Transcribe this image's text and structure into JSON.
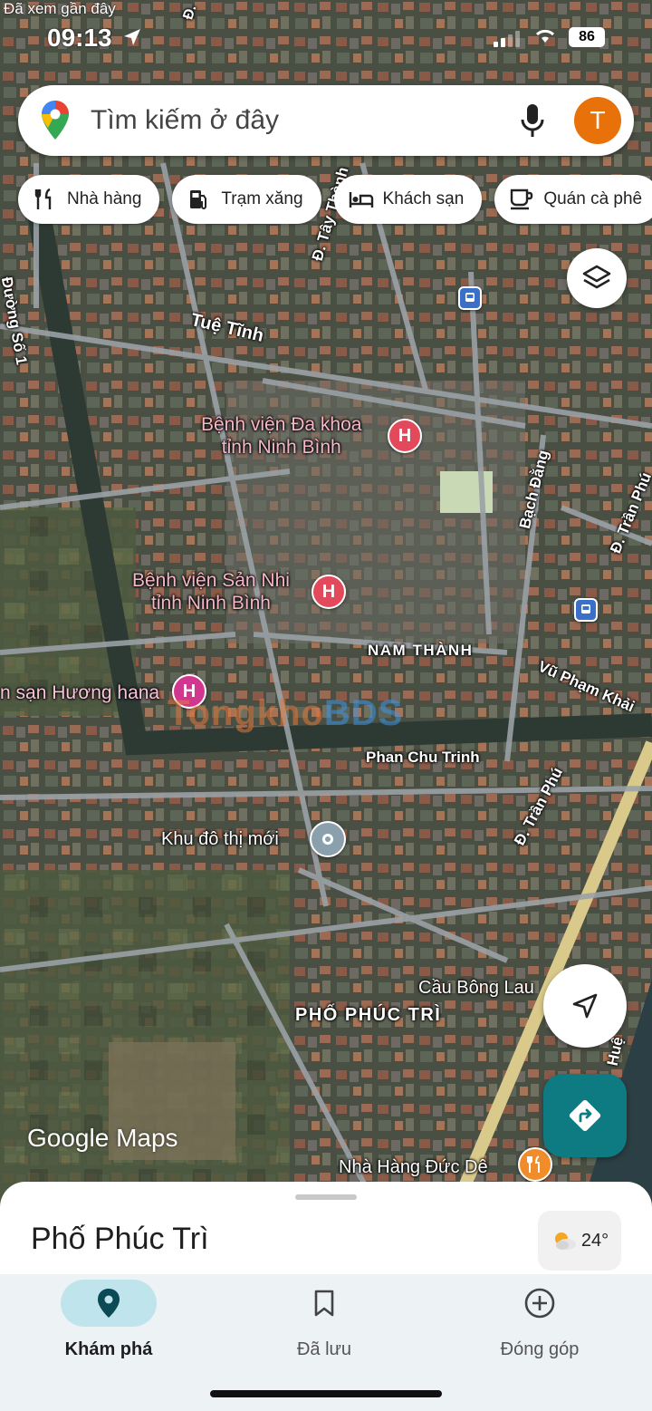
{
  "status": {
    "back_label": "Đã xem gần đây",
    "time": "09:13",
    "battery": "86"
  },
  "search": {
    "placeholder": "Tìm kiếm ở đây",
    "avatar_letter": "T"
  },
  "chips": [
    {
      "label": "Nhà hàng",
      "icon": "restaurant-icon"
    },
    {
      "label": "Trạm xăng",
      "icon": "gas-station-icon"
    },
    {
      "label": "Khách sạn",
      "icon": "hotel-icon"
    },
    {
      "label": "Quán cà phê",
      "icon": "coffee-icon"
    }
  ],
  "map": {
    "streets": {
      "tue_tinh": "Tuệ Tĩnh",
      "duong_so_1": "Đường Số 1",
      "tay_thanh": "Đ. Tây Thành",
      "bach_dang": "Bạch Đằng",
      "tran_phu_top": "Đ. Trần Phú",
      "vu_pham_khai": "Vũ Phạm Khải",
      "phan_chu_trinh": "Phan Chu Trinh",
      "tran_phu_bottom": "Đ. Trần Phú",
      "hue": "Huệ",
      "top_left": "Đ."
    },
    "places": {
      "hospital1_line1": "Bệnh viện Đa khoa",
      "hospital1_line2": "tỉnh Ninh Bình",
      "hospital2_line1": "Bệnh viện Sản Nhi",
      "hospital2_line2": "tỉnh Ninh Bình",
      "nam_thanh": "NAM THÀNH",
      "hotel": "n sạn Hương hana",
      "khu_do_thi": "Khu đô thị mới",
      "cau_bong_lau": "Cầu Bông Lau",
      "pho_phuc_tri": "PHỐ PHÚC TRÌ",
      "nha_hang": "Nhà Hàng Đức Dê"
    },
    "watermark_a": "Tongkho",
    "watermark_b": "BDS",
    "google_logo": "Google Maps"
  },
  "sheet": {
    "title": "Phố Phúc Trì",
    "temperature": "24°"
  },
  "nav": [
    {
      "label": "Khám phá",
      "active": true
    },
    {
      "label": "Đã lưu",
      "active": false
    },
    {
      "label": "Đóng góp",
      "active": false
    }
  ],
  "colors": {
    "accent": "#0e7a82",
    "avatar": "#e8710a",
    "hospital": "#e24a5c",
    "active_tab": "#bfe4ec"
  }
}
